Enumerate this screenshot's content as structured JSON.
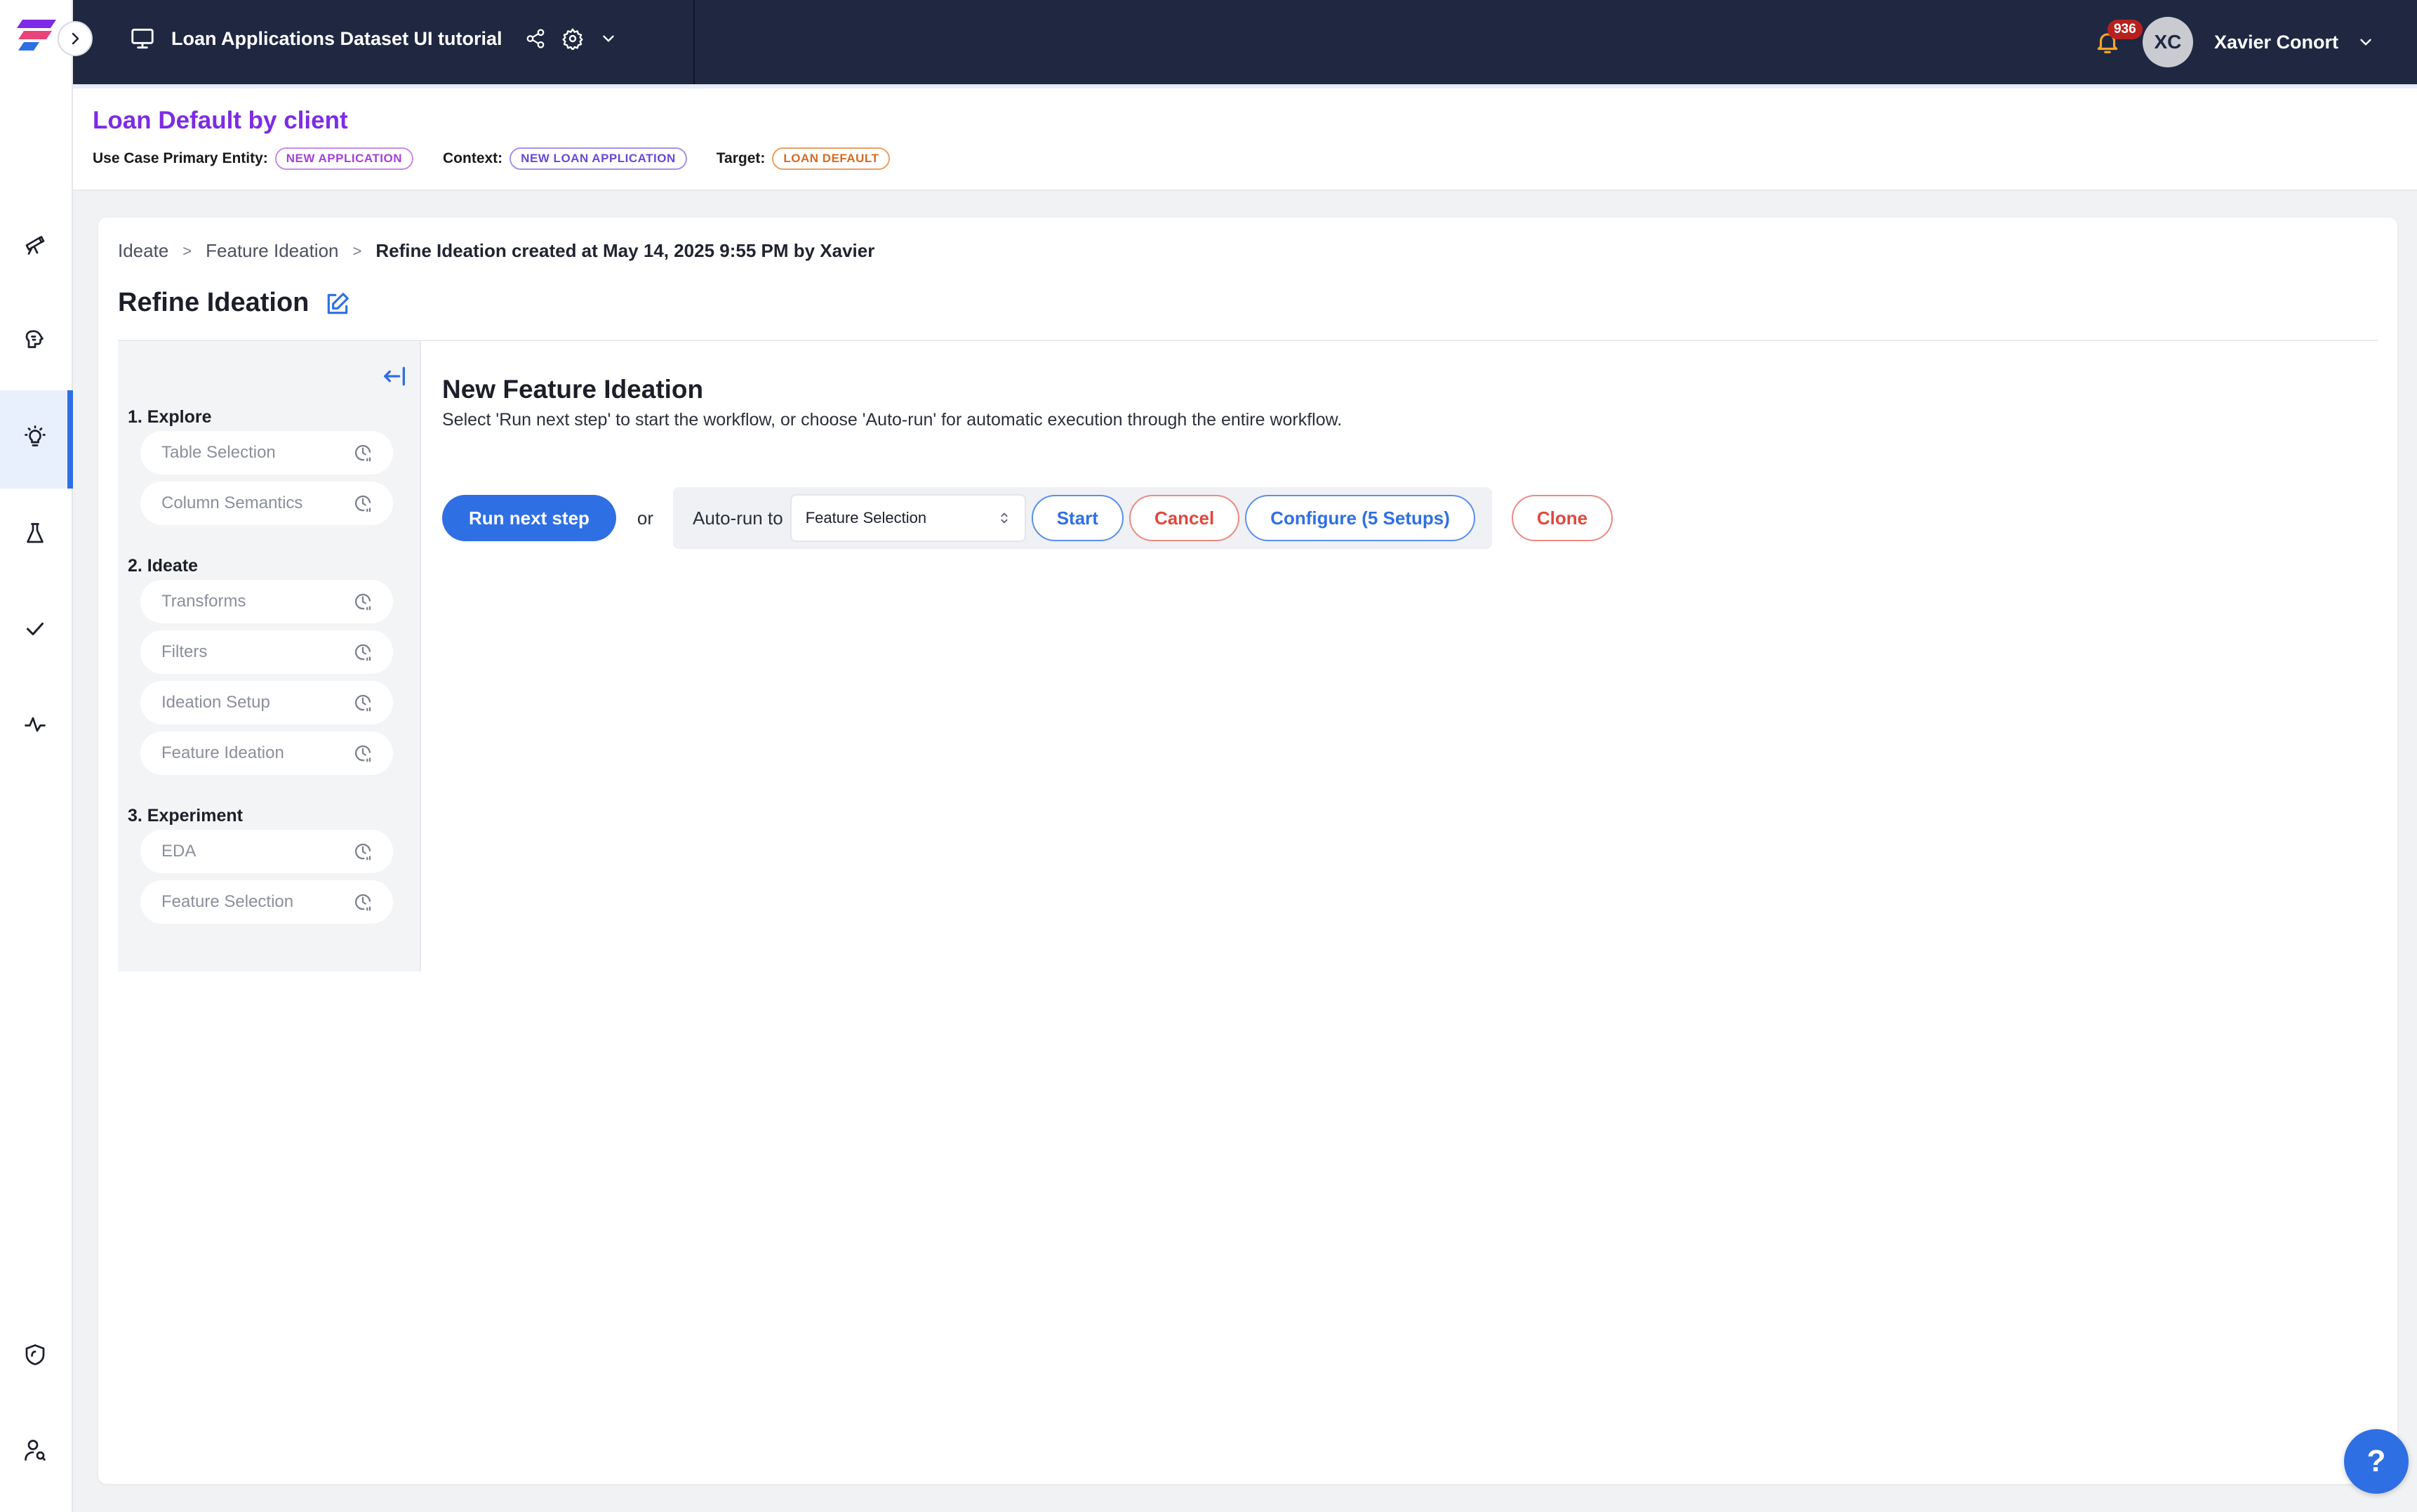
{
  "topbar": {
    "project_title": "Loan Applications Dataset UI tutorial",
    "notification_count": "936",
    "user_initials": "XC",
    "user_name": "Xavier Conort"
  },
  "use_case": {
    "title": "Loan Default by client",
    "primary_entity_label": "Use Case Primary Entity:",
    "primary_entity_value": "NEW APPLICATION",
    "context_label": "Context:",
    "context_value": "NEW LOAN APPLICATION",
    "target_label": "Target:",
    "target_value": "LOAN DEFAULT"
  },
  "breadcrumb": {
    "items": [
      "Ideate",
      "Feature Ideation"
    ],
    "separator": ">",
    "current": "Refine Ideation created at May 14, 2025 9:55 PM by Xavier"
  },
  "page": {
    "title": "Refine Ideation"
  },
  "steps": {
    "groups": [
      {
        "label": "1. Explore",
        "items": [
          "Table Selection",
          "Column Semantics"
        ]
      },
      {
        "label": "2. Ideate",
        "items": [
          "Transforms",
          "Filters",
          "Ideation Setup",
          "Feature Ideation"
        ]
      },
      {
        "label": "3. Experiment",
        "items": [
          "EDA",
          "Feature Selection"
        ]
      }
    ]
  },
  "ideation": {
    "title": "New Feature Ideation",
    "description": "Select 'Run next step' to start the workflow, or choose 'Auto-run' for automatic execution through the entire workflow.",
    "run_next_label": "Run next step",
    "or_label": "or",
    "autorun_label": "Auto-run to",
    "autorun_selected": "Feature Selection",
    "start_label": "Start",
    "cancel_label": "Cancel",
    "configure_label": "Configure (5 Setups)",
    "clone_label": "Clone"
  },
  "help": {
    "label": "?"
  },
  "colors": {
    "accent": "#2f6fe4",
    "topbar": "#1f2741",
    "use_case_title": "#7d2be6",
    "danger": "#e0483e",
    "notification": "#b82020"
  },
  "icons": {
    "rail": [
      "telescope-icon",
      "brain-icon",
      "lightbulb-icon",
      "flask-icon",
      "check-icon",
      "activity-icon",
      "shield-icon",
      "user-search-icon"
    ],
    "step_status": "clock-pending-icon"
  }
}
